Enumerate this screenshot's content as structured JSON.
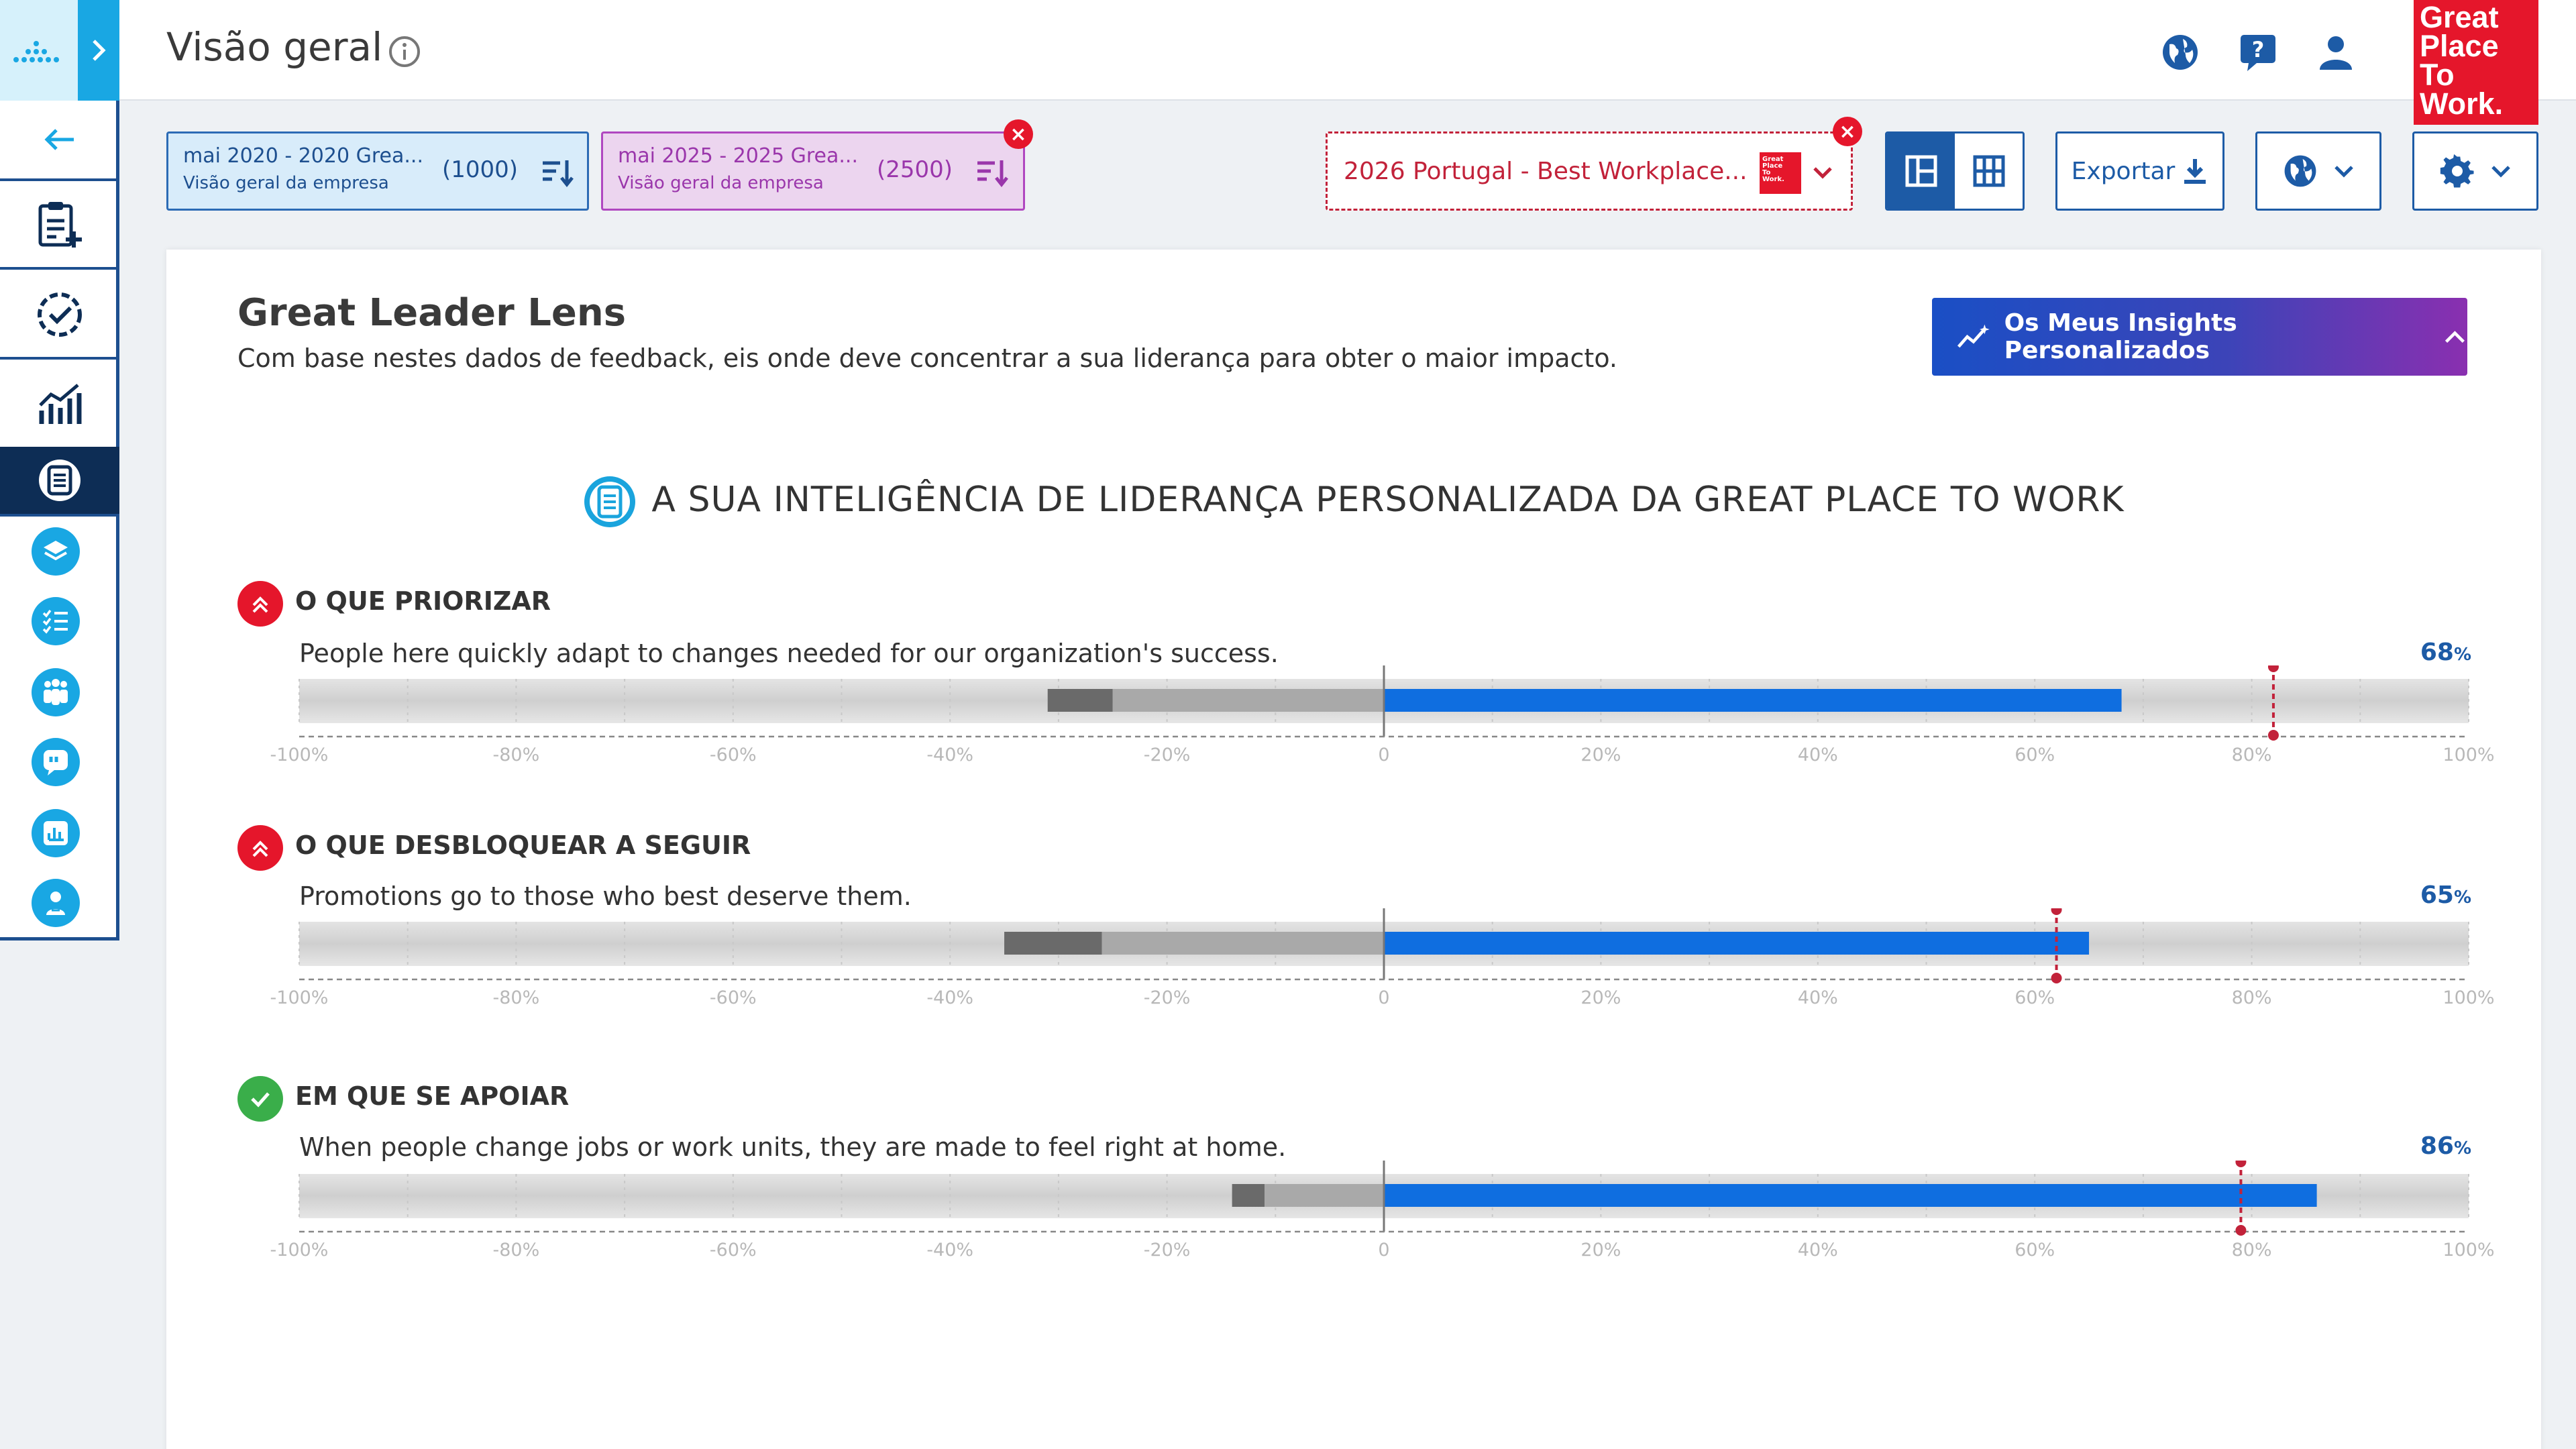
{
  "header": {
    "page_title": "Visão geral",
    "brand_logo": "Great Place To Work",
    "brand_color": "#e5162b",
    "icons": [
      "globe-icon",
      "help-chat-icon",
      "user-icon"
    ]
  },
  "filters": [
    {
      "period": "mai 2020 - 2020 Grea...",
      "count": "(1000)",
      "scope": "Visão geral da empresa"
    },
    {
      "period": "mai 2025 - 2025 Grea...",
      "count": "(2500)",
      "scope": "Visão geral da empresa"
    }
  ],
  "benchmark": {
    "label": "2026 Portugal - Best Workplace..."
  },
  "toolbar": {
    "export_label": "Exportar"
  },
  "card": {
    "title": "Great Leader Lens",
    "subtitle": "Com base nestes dados de feedback, eis onde deve concentrar a sua liderança para obter o maior impacto.",
    "insights_button": "Os Meus Insights Personalizados",
    "banner": "A SUA INTELIGÊNCIA DE LIDERANÇA PERSONALIZADA DA GREAT PLACE TO WORK"
  },
  "chart_data": {
    "type": "bar",
    "xlim": [
      -100,
      100
    ],
    "tick_labels": [
      "-100%",
      "-80%",
      "-60%",
      "-40%",
      "-20%",
      "0",
      "20%",
      "40%",
      "60%",
      "80%",
      "100%"
    ],
    "colors": {
      "positive": "#0f6ee0",
      "negative_dark": "#6a6a6a",
      "negative_light": "#a9a9a9",
      "marker": "#c2223a"
    },
    "sections": [
      {
        "title": "O QUE PRIORIZAR",
        "statement": "People here quickly adapt to changes needed for our organization's success.",
        "percent_value": "68",
        "percent_unit": "%",
        "positive": 68,
        "negative_light": -25,
        "negative_dark": -31,
        "benchmark": 82,
        "status": "priority"
      },
      {
        "title": "O QUE DESBLOQUEAR A SEGUIR",
        "statement": "Promotions go to those who best deserve them.",
        "percent_value": "65",
        "percent_unit": "%",
        "positive": 65,
        "negative_light": -26,
        "negative_dark": -35,
        "benchmark": 62,
        "status": "priority"
      },
      {
        "title": "EM QUE SE APOIAR",
        "statement": "When people change jobs or work units, they are made to feel right at home.",
        "percent_value": "86",
        "percent_unit": "%",
        "positive": 86,
        "negative_light": -11,
        "negative_dark": -14,
        "benchmark": 79,
        "status": "strength"
      }
    ]
  }
}
